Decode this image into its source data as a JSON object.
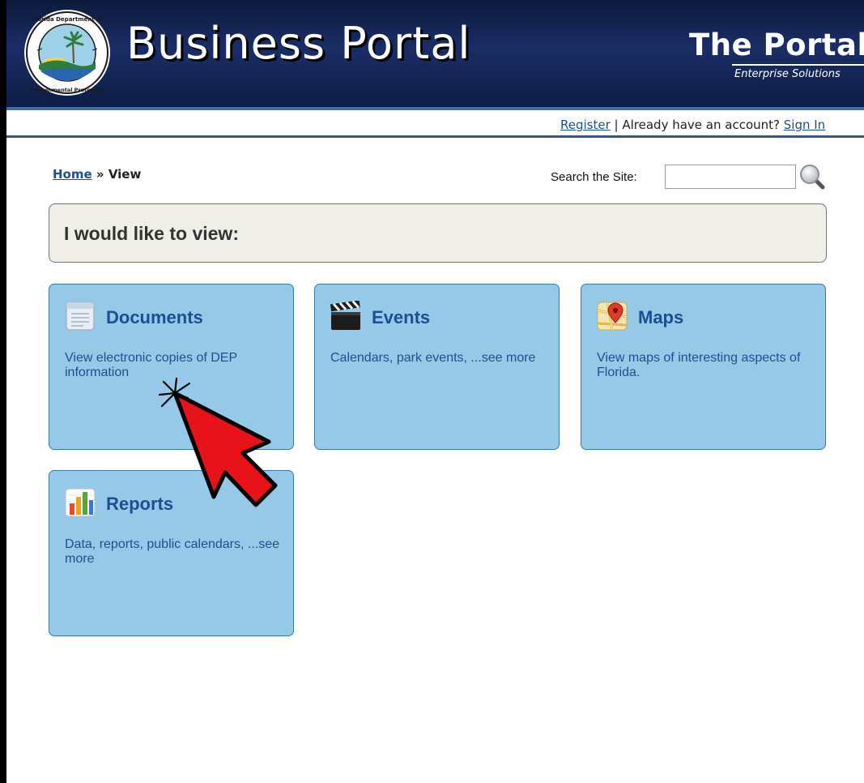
{
  "header": {
    "logo_text": "Florida Department of Environmental Protection",
    "portal_title": "Business Portal",
    "brand_name": "The Portal",
    "brand_tagline": "Enterprise Solutions"
  },
  "account_bar": {
    "register_label": "Register",
    "separator": " | ",
    "prompt": "Already have an account?",
    "sign_in_label": "Sign In"
  },
  "breadcrumb": {
    "home_label": "Home",
    "separator": " » ",
    "current_label": "View"
  },
  "search": {
    "label": "Search the Site:",
    "value": "",
    "button_icon": "magnifier-icon"
  },
  "heading": {
    "text": "I would like to view:"
  },
  "tiles": [
    {
      "title": "Documents",
      "description": "View electronic copies of DEP information",
      "icon": "document-icon"
    },
    {
      "title": "Events",
      "description": "Calendars, park events, ...see more",
      "icon": "clapperboard-icon"
    },
    {
      "title": "Maps",
      "description": "View maps of interesting aspects of Florida.",
      "icon": "map-pin-icon"
    },
    {
      "title": "Reports",
      "description": "Data, reports, public calendars, ...see more",
      "icon": "bar-chart-icon"
    }
  ],
  "annotation": {
    "icon": "red-pointer-arrow-icon",
    "color": "#e8121a"
  },
  "colors": {
    "banner": "#1b2d66",
    "tile_bg": "#96c8e8",
    "tile_text": "#1b4f91",
    "link": "#1f4f8f",
    "heading_panel_bg": "#f0efe7"
  }
}
